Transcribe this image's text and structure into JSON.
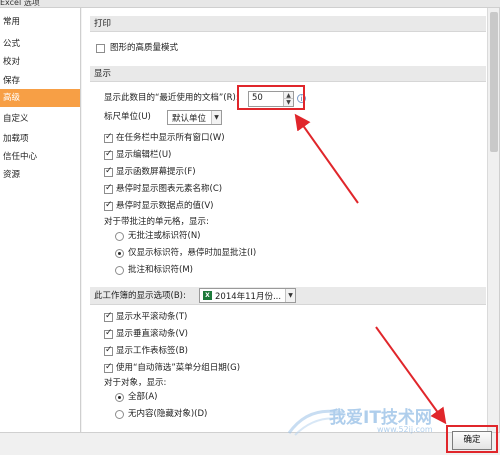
{
  "window": {
    "title": "Excel 选项"
  },
  "nav": {
    "items": [
      {
        "label": "常用",
        "active": false
      },
      {
        "label": "公式",
        "active": false
      },
      {
        "label": "校对",
        "active": false
      },
      {
        "label": "保存",
        "active": false
      },
      {
        "label": "高级",
        "active": true
      },
      {
        "label": "自定义",
        "active": false
      },
      {
        "label": "加载项",
        "active": false
      },
      {
        "label": "信任中心",
        "active": false
      },
      {
        "label": "资源",
        "active": false
      }
    ]
  },
  "print_section": {
    "header": "打印",
    "hq_graphics": {
      "label": "图形的高质量模式",
      "checked": false
    }
  },
  "display_section": {
    "header": "显示",
    "recent_docs": {
      "label": "显示此数目的“最近使用的文档”(R):",
      "value": "50"
    },
    "ruler_units": {
      "label": "标尺单位(U)",
      "value": "默认单位"
    },
    "checkboxes": [
      {
        "label": "在任务栏中显示所有窗口(W)",
        "checked": true
      },
      {
        "label": "显示编辑栏(U)",
        "checked": true
      },
      {
        "label": "显示函数屏幕提示(F)",
        "checked": true
      },
      {
        "label": "悬停时显示图表元素名称(C)",
        "checked": true
      },
      {
        "label": "悬停时显示数据点的值(V)",
        "checked": true
      }
    ],
    "comments_label": "对于带批注的单元格，显示:",
    "comment_options": [
      {
        "label": "无批注或标识符(N)",
        "checked": false
      },
      {
        "label": "仅显示标识符，悬停时加显批注(I)",
        "checked": true
      },
      {
        "label": "批注和标识符(M)",
        "checked": false
      }
    ]
  },
  "workbook_section": {
    "header": "此工作簿的显示选项(B):",
    "workbook": "2014年11月份...",
    "checkboxes": [
      {
        "label": "显示水平滚动条(T)",
        "checked": true
      },
      {
        "label": "显示垂直滚动条(V)",
        "checked": true
      },
      {
        "label": "显示工作表标签(B)",
        "checked": true
      },
      {
        "label": "使用“自动筛选”菜单分组日期(G)",
        "checked": true
      }
    ],
    "objects_label": "对于对象，显示:",
    "object_options": [
      {
        "label": "全部(A)",
        "checked": true
      },
      {
        "label": "无内容(隐藏对象)(D)",
        "checked": false
      }
    ]
  },
  "buttons": {
    "ok": "确定"
  },
  "watermark": {
    "line1": "我爱IT技术网",
    "line2": "www.52ij.com"
  },
  "colors": {
    "accent": "#f79f45",
    "annotation": "#e0262b"
  }
}
